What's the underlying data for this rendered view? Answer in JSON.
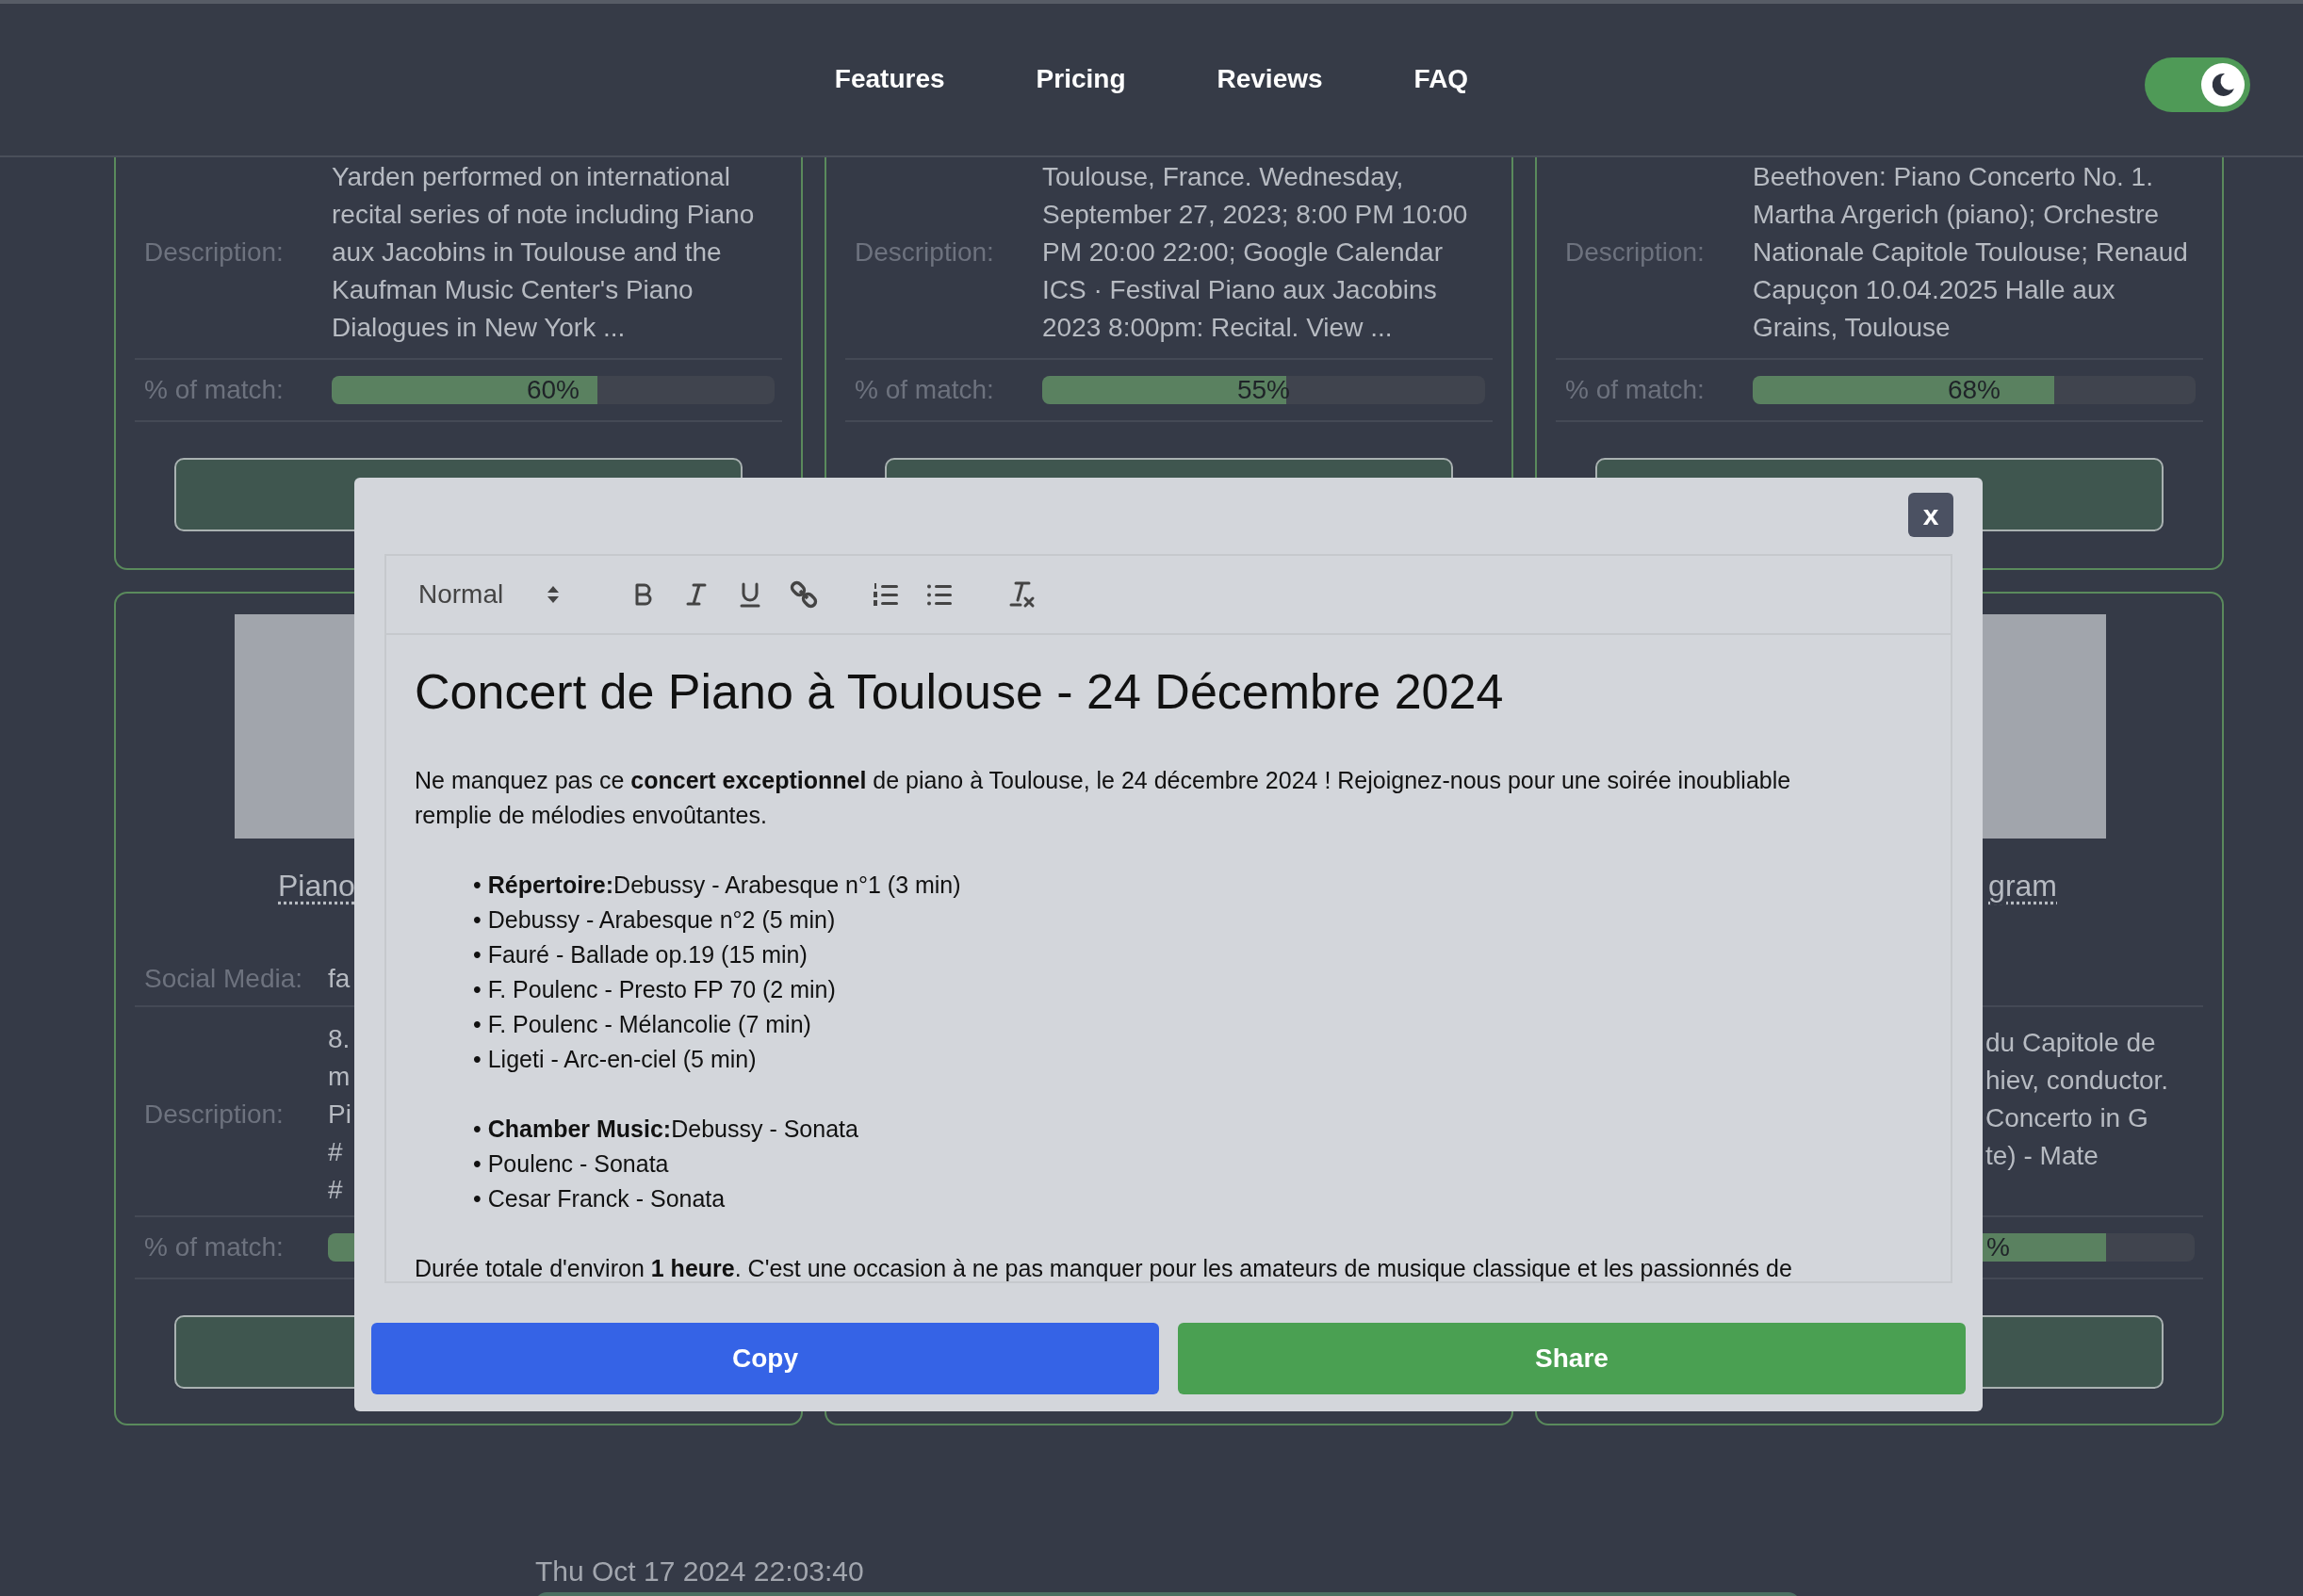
{
  "header": {
    "nav": [
      "Features",
      "Pricing",
      "Reviews",
      "FAQ"
    ],
    "theme_toggle": {
      "on": true
    }
  },
  "cards": [
    {
      "description_label": "Description:",
      "description_lines": [
        "Yarden performed on international",
        "recital series of note including Piano",
        "aux Jacobins in Toulouse and the",
        "Kaufman Music Center's Piano",
        "Dialogues in New York ..."
      ],
      "match_label": "% of match:",
      "match": {
        "level": 0.6,
        "reading": "60%"
      }
    },
    {
      "description_label": "Description:",
      "description_lines": [
        "Toulouse, France. Wednesday,",
        "September 27, 2023; 8:00 PM 10:00",
        "PM 20:00 22:00; Google Calendar",
        "ICS · Festival Piano aux Jacobins",
        "2023 8:00pm: Recital. View ..."
      ],
      "match_label": "% of match:",
      "match": {
        "level": 0.55,
        "reading": "55%"
      }
    },
    {
      "description_label": "Description:",
      "description_lines": [
        "Beethoven: Piano Concerto No. 1.",
        "Martha Argerich (piano); Orchestre",
        "Nationale Capitole Toulouse; Renaud",
        "Capuçon 10.04.2025 Halle aux",
        "Grains, Toulouse"
      ],
      "match_label": "% of match:",
      "match": {
        "level": 0.68,
        "reading": "68%"
      }
    }
  ],
  "bottom_cards": [
    {
      "kind": "cut-right",
      "title": "Piano",
      "social_label": "Social Media:",
      "social_value": "fa",
      "description_label": "Description:",
      "description_lines": [
        "8.",
        "m",
        "Pi",
        "#",
        "#"
      ],
      "match_label": "% of match:"
    },
    {
      "kind": "hidden"
    },
    {
      "kind": "cut-left",
      "title": "gram",
      "description_lines": [
        "du Capitole de",
        "hiev, conductor.",
        "Concerto in G",
        "te) - Mate"
      ],
      "match": {
        "level": 0.8,
        "reading": "%"
      }
    }
  ],
  "modal": {
    "close": "x",
    "toolbar": {
      "format": "Normal"
    },
    "heading": "Concert de Piano à Toulouse - 24 Décembre 2024",
    "intro": "Ne manquez pas ce **concert exceptionnel** de piano à Toulouse, le 24 décembre 2024 ! Rejoignez-nous pour une soirée inoubliable remplie de mélodies envoûtantes.",
    "lists": [
      [
        "• **Répertoire:**Debussy - Arabesque n°1 (3 min)",
        "• Debussy - Arabesque n°2 (5 min)",
        "• Fauré - Ballade op.19 (15 min)",
        "• F. Poulenc - Presto FP 70 (2 min)",
        "• F. Poulenc - Mélancolie (7 min)",
        "• Ligeti - Arc-en-ciel (5 min)"
      ],
      [
        "• **Chamber Music:**Debussy - Sonata",
        "• Poulenc - Sonata",
        "• Cesar Franck - Sonata"
      ]
    ],
    "outro": "Durée totale d'environ **1 heure**. C'est une occasion à ne pas manquer pour les amateurs de musique classique et les passionnés de",
    "buttons": [
      "Copy",
      "Share"
    ]
  },
  "timestamp": "Thu Oct 17 2024 22:03:40"
}
